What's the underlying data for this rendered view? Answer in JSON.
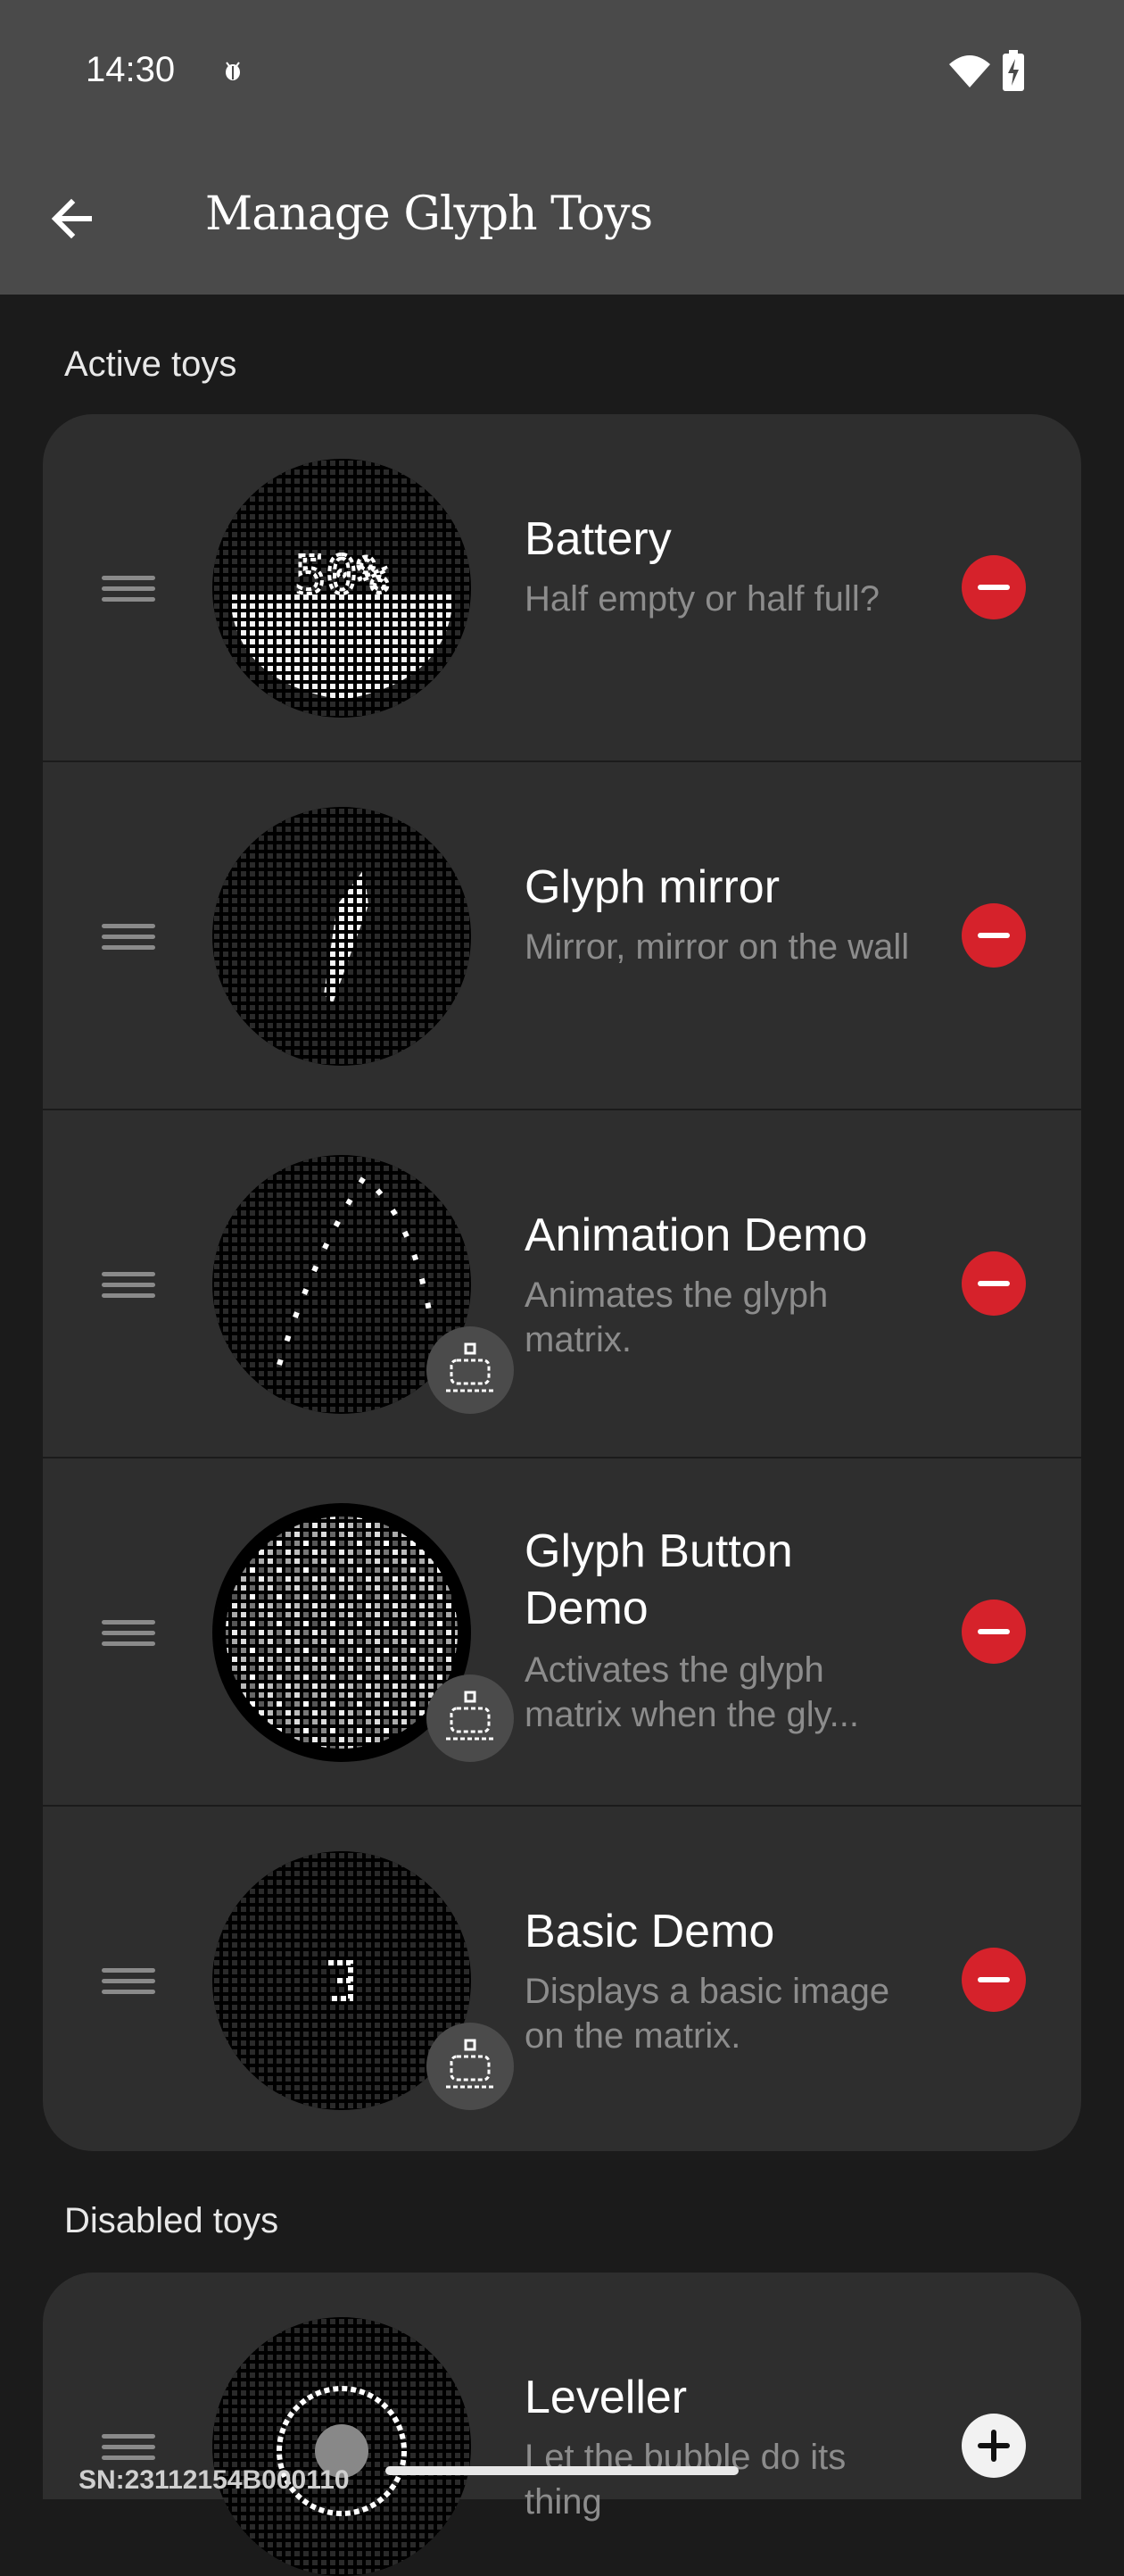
{
  "status_bar": {
    "time": "14:30"
  },
  "app_bar": {
    "title": "Manage Glyph Toys"
  },
  "sections": {
    "active_label": "Active toys",
    "disabled_label": "Disabled toys"
  },
  "active_toys": [
    {
      "name": "Battery",
      "description": "Half empty or half full?",
      "thumb_text": "50%"
    },
    {
      "name": "Glyph mirror",
      "description": "Mirror, mirror on the wall"
    },
    {
      "name": "Animation Demo",
      "description": "Animates the glyph matrix."
    },
    {
      "name": "Glyph Button Demo",
      "description": "Activates the glyph matrix when the gly..."
    },
    {
      "name": "Basic Demo",
      "description": "Displays a basic image on the matrix."
    }
  ],
  "disabled_toys": [
    {
      "name": "Leveller",
      "description": "Let the bubble do its thing"
    }
  ],
  "footer": {
    "serial": "SN:23112154B000110"
  },
  "colors": {
    "background": "#1b1b1b",
    "bar": "#4a4a4a",
    "card": "#2e2e2e",
    "remove": "#d6222b"
  },
  "icons": [
    "back-arrow-icon",
    "bug-icon",
    "wifi-icon",
    "battery-charging-icon",
    "drag-handle-icon",
    "remove-icon",
    "add-icon",
    "demo-badge-icon"
  ]
}
